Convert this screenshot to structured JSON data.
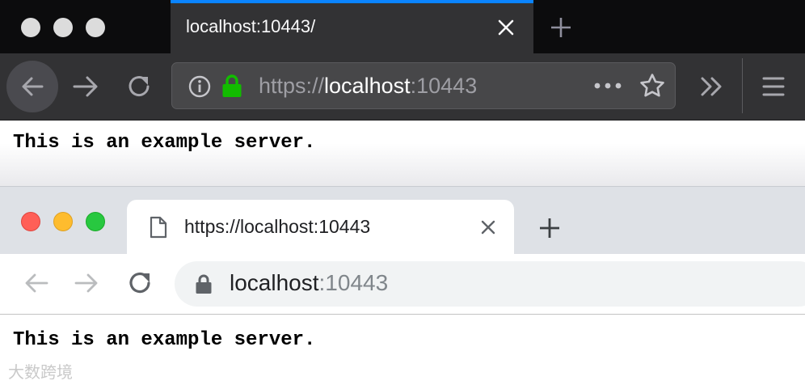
{
  "firefox": {
    "tab_title": "localhost:10443/",
    "url_scheme": "https://",
    "url_host": "localhost",
    "url_port": ":10443",
    "accent_color": "#0a84ff",
    "lock_color": "#12bc00",
    "icons": [
      "back-icon",
      "forward-icon",
      "reload-icon",
      "info-icon",
      "lock-icon",
      "page-actions-icon",
      "bookmark-star-icon",
      "overflow-icon",
      "hamburger-menu-icon",
      "close-icon",
      "plus-icon"
    ],
    "page_text": "This is an example server."
  },
  "chrome": {
    "tab_title": "https://localhost:10443",
    "url_host": "localhost",
    "url_port": ":10443",
    "traffic_light_colors": [
      "#ff5f57",
      "#febc2e",
      "#28c840"
    ],
    "icons": [
      "document-icon",
      "close-icon",
      "plus-icon",
      "back-icon",
      "forward-icon",
      "reload-icon",
      "lock-icon"
    ],
    "page_text": "This is an example server."
  },
  "watermark": "大数跨境"
}
